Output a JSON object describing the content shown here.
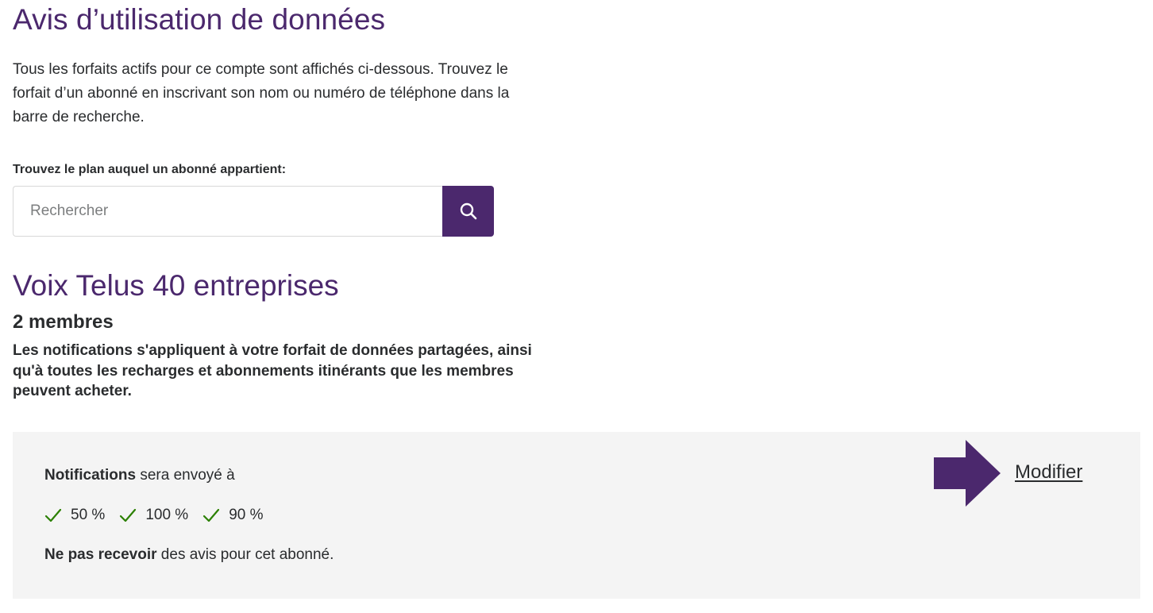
{
  "header": {
    "title": "Avis d’utilisation de données",
    "intro": "Tous les forfaits actifs pour ce compte sont affichés ci-dessous. Trouvez le forfait d’un abonné en inscrivant son nom ou numéro de téléphone dans la barre de recherche."
  },
  "search": {
    "label": "Trouvez le plan auquel un abonné appartient:",
    "placeholder": "Rechercher",
    "value": "",
    "button_icon": "search-icon"
  },
  "plan": {
    "title": "Voix Telus 40 entreprises",
    "members": "2 membres",
    "description": "Les notifications s'appliquent à votre forfait de données partagées, ainsi qu'à toutes les recharges et abonnements itinérants que les membres peuvent acheter."
  },
  "notifications": {
    "label_bold": "Notifications",
    "label_rest": " sera envoyé à",
    "thresholds": [
      "50 %",
      "100 %",
      "90 %"
    ],
    "check_icon": "check-icon",
    "no_receive_bold": "Ne pas recevoir",
    "no_receive_rest": " des avis pour cet abonné.",
    "edit_label": "Modifier",
    "arrow_icon": "right-arrow-icon"
  },
  "colors": {
    "brand": "#4b286d",
    "check": "#2b8000",
    "panel_bg": "#f4f4f4",
    "text": "#2a2c2e"
  }
}
